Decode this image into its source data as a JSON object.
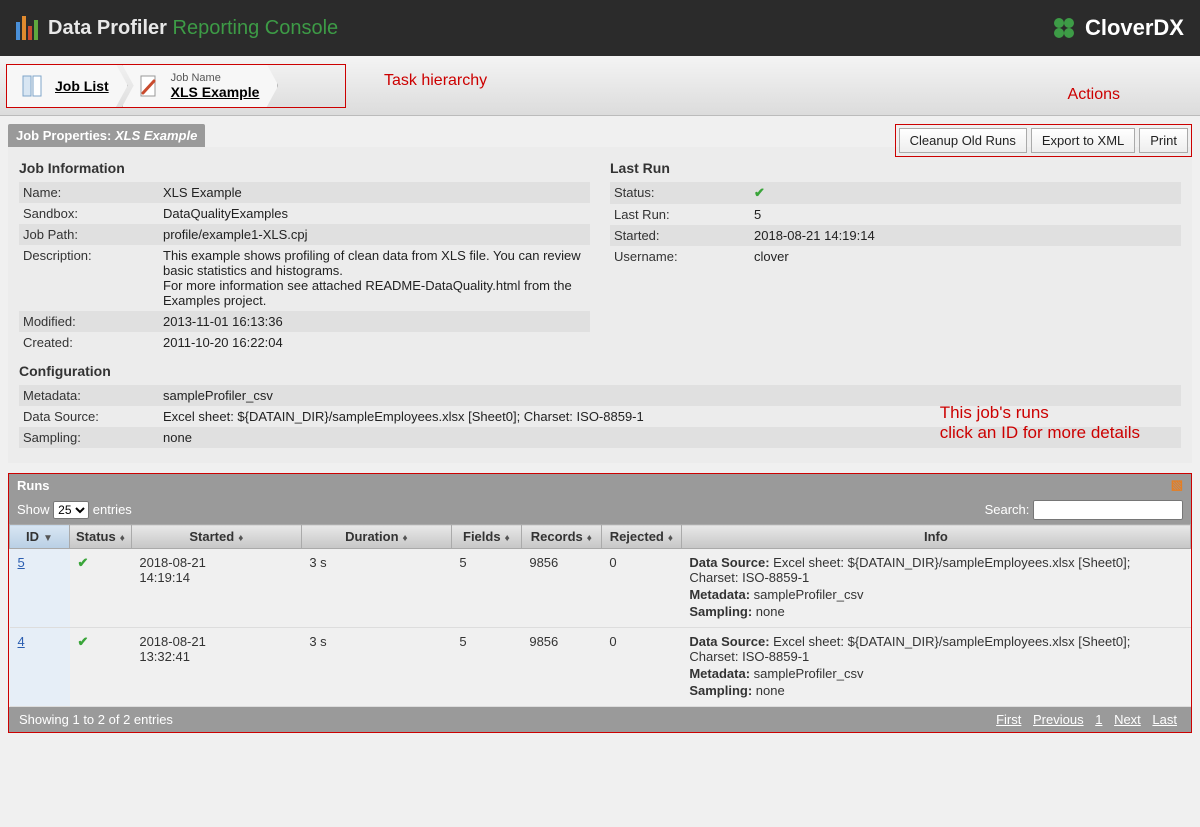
{
  "header": {
    "title": "Data Profiler",
    "subtitle": "Reporting Console",
    "brand": "CloverDX"
  },
  "breadcrumb": {
    "job_list": "Job List",
    "job_name_label": "Job Name",
    "job_name": "XLS Example"
  },
  "annotations": {
    "task_hierarchy": "Task hierarchy",
    "actions": "Actions",
    "runs_note_l1": "This job's runs",
    "runs_note_l2": "click an ID for more details"
  },
  "panel": {
    "title_prefix": "Job Properties: ",
    "title_job": "XLS Example"
  },
  "actions": {
    "cleanup": "Cleanup Old Runs",
    "export": "Export to XML",
    "print": "Print"
  },
  "job_info": {
    "heading": "Job Information",
    "name_l": "Name:",
    "name_v": "XLS Example",
    "sandbox_l": "Sandbox:",
    "sandbox_v": "DataQualityExamples",
    "path_l": "Job Path:",
    "path_v": "profile/example1-XLS.cpj",
    "desc_l": "Description:",
    "desc_v": "This example shows profiling of clean data from XLS file. You can review basic statistics and histograms.\nFor more information see attached README-DataQuality.html from the Examples project.",
    "modified_l": "Modified:",
    "modified_v": "2013-11-01 16:13:36",
    "created_l": "Created:",
    "created_v": "2011-10-20 16:22:04"
  },
  "last_run": {
    "heading": "Last Run",
    "status_l": "Status:",
    "status_v": "ok",
    "lastrun_l": "Last Run:",
    "lastrun_v": "5",
    "started_l": "Started:",
    "started_v": "2018-08-21 14:19:14",
    "user_l": "Username:",
    "user_v": "clover"
  },
  "config": {
    "heading": "Configuration",
    "metadata_l": "Metadata:",
    "metadata_v": "sampleProfiler_csv",
    "ds_l": "Data Source:",
    "ds_v": "Excel sheet: ${DATAIN_DIR}/sampleEmployees.xlsx [Sheet0]; Charset: ISO-8859-1",
    "sampling_l": "Sampling:",
    "sampling_v": "none"
  },
  "runs": {
    "title": "Runs",
    "show_label": "Show",
    "entries_label": "entries",
    "page_size": "25",
    "search_label": "Search:",
    "cols": {
      "id": "ID",
      "status": "Status",
      "started": "Started",
      "duration": "Duration",
      "fields": "Fields",
      "records": "Records",
      "rejected": "Rejected",
      "info": "Info"
    },
    "rows": [
      {
        "id": "5",
        "started": "2018-08-21 14:19:14",
        "duration": "3 s",
        "fields": "5",
        "records": "9856",
        "rejected": "0"
      },
      {
        "id": "4",
        "started": "2018-08-21 13:32:41",
        "duration": "3 s",
        "fields": "5",
        "records": "9856",
        "rejected": "0"
      }
    ],
    "info_ds_label": "Data Source: ",
    "info_ds": "Excel sheet: ${DATAIN_DIR}/sampleEmployees.xlsx [Sheet0]; Charset: ISO-8859-1",
    "info_meta_label": "Metadata: ",
    "info_meta": "sampleProfiler_csv",
    "info_samp_label": "Sampling: ",
    "info_samp": "none",
    "footer_showing": "Showing 1 to 2 of 2 entries",
    "pager": {
      "first": "First",
      "prev": "Previous",
      "page": "1",
      "next": "Next",
      "last": "Last"
    }
  }
}
